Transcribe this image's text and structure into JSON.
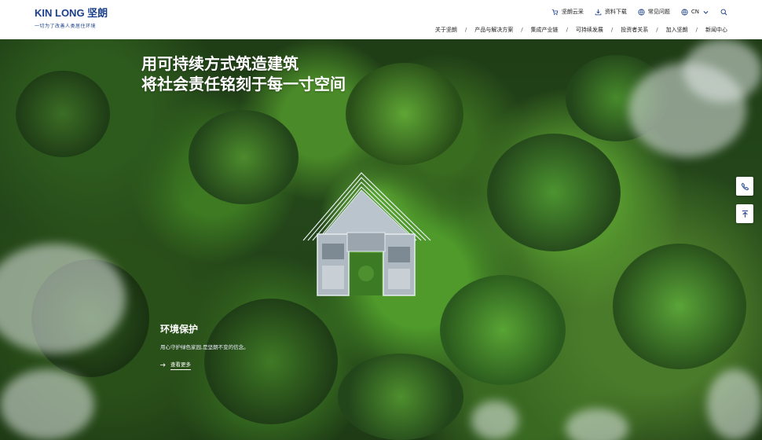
{
  "header": {
    "logo": {
      "brand": "KIN LONG 坚朗",
      "slogan": "一切为了改善人类居住环境"
    },
    "utility": [
      {
        "label": "坚朗云采",
        "icon": "cart-icon"
      },
      {
        "label": "资料下载",
        "icon": "download-icon"
      },
      {
        "label": "常见问题",
        "icon": "globe-faq-icon"
      },
      {
        "label": "CN",
        "icon": "globe-icon"
      }
    ],
    "nav": [
      "关于坚朗",
      "产品与解决方案",
      "集成产业链",
      "可持续发展",
      "投资者关系",
      "加入坚朗",
      "新闻中心"
    ],
    "nav_separator": "/"
  },
  "hero": {
    "headline_line1": "用可持续方式筑造建筑",
    "headline_line2": "将社会责任铭刻于每一寸空间",
    "section_title": "环境保护",
    "section_desc": "用心守护绿色家园,是坚朗不变的信念。",
    "more_label": "查看更多"
  },
  "colors": {
    "brand_blue": "#1a3f8a",
    "header_bg": "#ffffff",
    "text_white": "#ffffff"
  }
}
